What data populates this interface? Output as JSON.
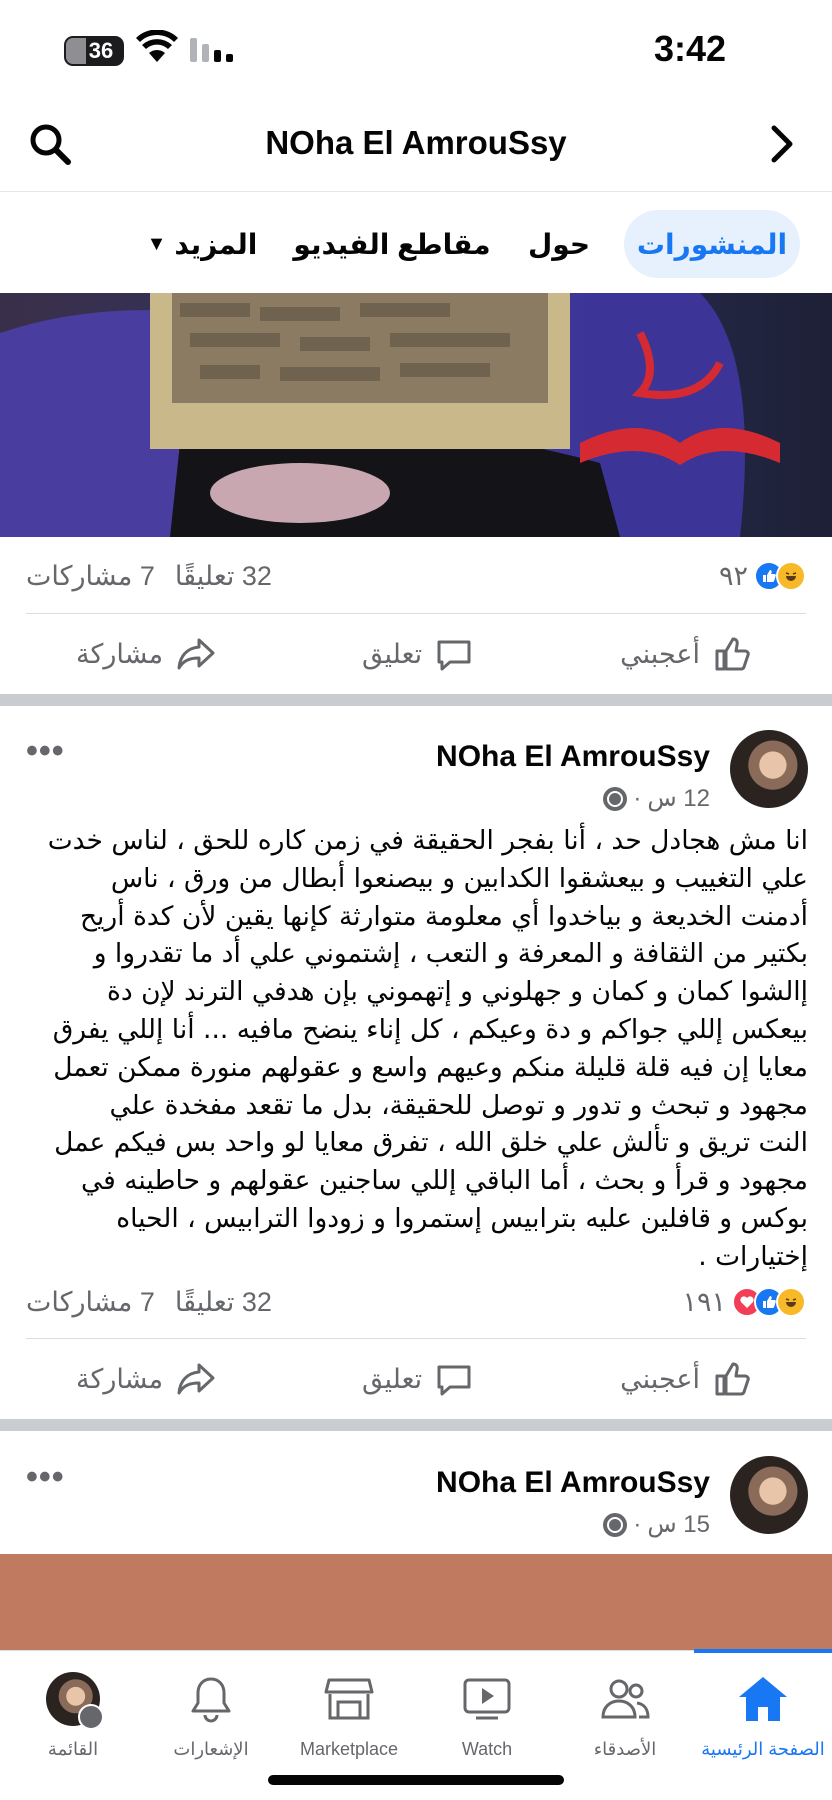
{
  "status_bar": {
    "time": "3:42",
    "battery": "36"
  },
  "header": {
    "title": "NOha El AmrouSsy"
  },
  "tabs": [
    {
      "label": "المنشورات",
      "active": true
    },
    {
      "label": "حول",
      "active": false
    },
    {
      "label": "مقاطع الفيديو",
      "active": false
    },
    {
      "label": "المزيد",
      "active": false
    }
  ],
  "post1": {
    "reactions_count": "٩٢",
    "shares": "7 مشاركات",
    "comments": "32 تعليقًا",
    "actions": {
      "like": "أعجبني",
      "comment": "تعليق",
      "share": "مشاركة"
    }
  },
  "post2": {
    "author": "NOha El AmrouSsy",
    "time": "12 س",
    "text_lines": [
      "انا مش هجادل حد ، أنا بفجر الحقيقة في زمن كاره للحق ، لناس خدت",
      "علي التغييب و بيعشقوا الكدابين و بيصنعوا أبطال من ورق ، ناس",
      "أدمنت الخديعة و بياخدوا أي معلومة متوارثة كإنها يقين لأن كدة أريح",
      "بكتير  من الثقافة و المعرفة و التعب ، إشتموني علي أد ما تقدروا و",
      "إالشوا كمان و كمان و جهلوني و إتهموني بإن هدفي الترند لإن  دة",
      "بيعكس إللي جواكم و دة وعيكم ، كل إناء ينضح مافيه ... أنا إللي يفرق",
      "معايا إن فيه قلة قليلة منكم وعيهم واسع و عقولهم منورة ممكن تعمل",
      "مجهود و تبحث و تدور و توصل للحقيقة، بدل ما تقعد مفخدة علي",
      "النت تريق و تألش علي خلق الله ، تفرق معايا لو واحد بس فيكم عمل",
      "مجهود و قرأ و بحث ، أما الباقي إللي ساجنين عقولهم و حاطينه في",
      "بوكس و قافلين عليه بترابيس إستمروا و زودوا الترابيس ، الحياه",
      "إختيارات ."
    ],
    "reactions_count": "١٩١",
    "shares": "7 مشاركات",
    "comments": "32 تعليقًا",
    "actions": {
      "like": "أعجبني",
      "comment": "تعليق",
      "share": "مشاركة"
    }
  },
  "post3": {
    "author": "NOha El AmrouSsy",
    "time": "15 س"
  },
  "bottom_nav": {
    "home": "الصفحة الرئيسية",
    "friends": "الأصدقاء",
    "watch": "Watch",
    "marketplace": "Marketplace",
    "notifications": "الإشعارات",
    "menu": "القائمة"
  },
  "colors": {
    "accent": "#1877f2",
    "tab_active_bg": "#e7f0fd",
    "secondary_text": "#65676b"
  }
}
